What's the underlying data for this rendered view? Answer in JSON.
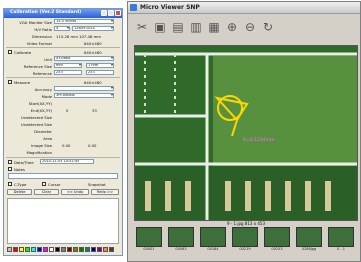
{
  "calibration": {
    "title": "Calibration (Ver.2 Standard)",
    "rows": [
      {
        "label": "VGA Monitor Size",
        "value": "15.0 inches",
        "kind": "select"
      },
      {
        "label": "H/V Ratio",
        "value": "4",
        "value2": "1280×1024",
        "kind": "select2"
      },
      {
        "label": "Dimension",
        "value": "115.28 mm   107.48 mm",
        "kind": "text"
      },
      {
        "label": "Video Format",
        "value": "640×480",
        "kind": "text"
      }
    ],
    "calibrate": {
      "label": "Calibrate",
      "value": "640×480"
    },
    "unit": {
      "label": "Unit",
      "value": "XY-Ratio"
    },
    "reference_size": {
      "label": "Reference Size",
      "value": "mm",
      "value2": "1 mm"
    },
    "reference": {
      "label": "Reference",
      "value": "253",
      "value2": "253"
    },
    "measure": {
      "label": "Measure",
      "value": "640×480"
    },
    "accuracy": {
      "label": "Accuracy",
      "value": ""
    },
    "mode": {
      "label": "Mode",
      "value": "3Pt-Radius"
    },
    "stat": {
      "label": "Start(XX,YY)",
      "value": ""
    },
    "end": {
      "label": "End(XX,YY)",
      "value": "0",
      "value2": "33"
    },
    "hdist": {
      "label": "Undetected Size",
      "value": ""
    },
    "vdist": {
      "label": "Undetected Size",
      "value": ""
    },
    "diameter": {
      "label": "Diameter",
      "value": ""
    },
    "area": {
      "label": "Area",
      "value": ""
    },
    "image_size": {
      "label": "Image Size",
      "value": "0.00",
      "value2": "0.00"
    },
    "magnification": {
      "label": "Magnification",
      "value": ""
    },
    "date_time": {
      "label": "Date/Time",
      "value": "2010-11-03   14:52:45"
    },
    "notes_label": "Notes",
    "ctype_label": "C-Type",
    "cursor_label": "Cursor",
    "snapshot_label": "Snapshot",
    "buttons": [
      "Delete",
      "Clear",
      "<< Undo",
      "Redo >>"
    ],
    "colors": [
      "#c0c0c0",
      "#ff0000",
      "#ffff00",
      "#00ff00",
      "#00ffff",
      "#0000ff",
      "#ff00ff",
      "#ffffff",
      "#000000",
      "#808080",
      "#800000",
      "#808000",
      "#008000",
      "#008080",
      "#000080",
      "#800080",
      "#ff8040",
      "#404040"
    ]
  },
  "viewer": {
    "title": "Micro Viewer SNP",
    "toolbar_icons": [
      "scissors-icon",
      "camera-icon",
      "folder-icon",
      "save-icon",
      "print-icon",
      "zoom-in-icon",
      "zoom-out-icon",
      "rotate-icon"
    ],
    "measure_label": "R=0.1234mm",
    "status_text": "9 - 1.jpg 813 x 453",
    "thumbnails": [
      {
        "label": "00001"
      },
      {
        "label": "00063"
      },
      {
        "label": "00184"
      },
      {
        "label": "00219"
      },
      {
        "label": "00253"
      },
      {
        "label": "0288jpg"
      },
      {
        "label": "0 - 1"
      }
    ]
  }
}
